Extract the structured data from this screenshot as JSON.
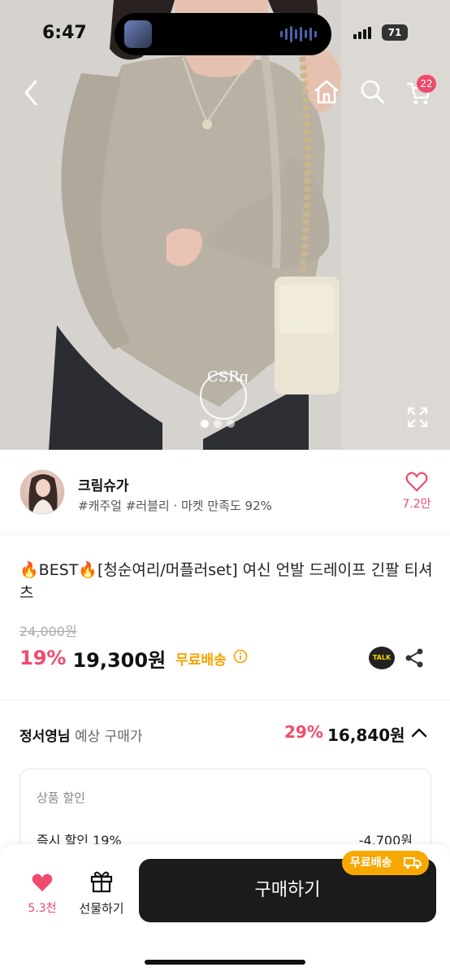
{
  "status_bar": {
    "time": "6:47",
    "battery": "71"
  },
  "nav": {
    "cart_count": "22"
  },
  "hero": {
    "watermark": "CSRg",
    "slide_total": 3,
    "slide_current": 1
  },
  "seller": {
    "name": "크림슈가",
    "tags": "#캐주얼 #러블리 · 마켓 만족도 92%",
    "likes": "7.2만"
  },
  "product": {
    "title": "🔥BEST🔥[청순여리/머플러set] 여신 언발 드레이프 긴팔 티셔츠",
    "original_price": "24,000원",
    "discount": "19%",
    "price": "19,300원",
    "free_shipping": "무료배송",
    "talk_label": "TALK"
  },
  "expected": {
    "user": "정서영님",
    "label": "예상 구매가",
    "discount": "29%",
    "price": "16,840원"
  },
  "breakdown": {
    "title": "상품 할인",
    "items": [
      {
        "label": "즉시 할인 19%",
        "value": "-4,700원"
      }
    ]
  },
  "bottom_bar": {
    "wish_count": "5.3천",
    "gift_label": "선물하기",
    "buy_label": "구매하기",
    "ship_badge": "무료배송"
  },
  "colors": {
    "accent": "#f04b6c",
    "ship": "#f5a300",
    "buy_bg": "#1b1b1b"
  }
}
